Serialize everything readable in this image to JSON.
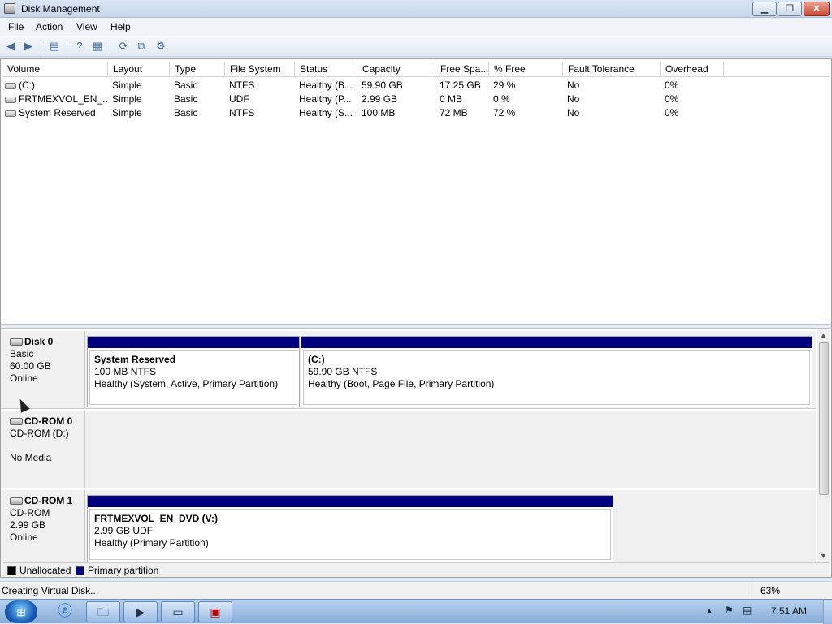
{
  "window": {
    "title": "Disk Management"
  },
  "menu": {
    "items": [
      "File",
      "Action",
      "View",
      "Help"
    ]
  },
  "toolbar": {
    "buttons": [
      "back-icon",
      "forward-icon",
      "console-tree-icon",
      "help-icon",
      "properties-icon",
      "refresh-icon",
      "rescan-icon",
      "settings-icon"
    ]
  },
  "volumes": {
    "columns": [
      "Volume",
      "Layout",
      "Type",
      "File System",
      "Status",
      "Capacity",
      "Free Spa...",
      "% Free",
      "Fault Tolerance",
      "Overhead"
    ],
    "rows": [
      {
        "volume": "(C:)",
        "layout": "Simple",
        "type": "Basic",
        "fs": "NTFS",
        "status": "Healthy (B...",
        "capacity": "59.90 GB",
        "free": "17.25 GB",
        "pfree": "29 %",
        "fault": "No",
        "overhead": "0%"
      },
      {
        "volume": "FRTMEXVOL_EN_...",
        "layout": "Simple",
        "type": "Basic",
        "fs": "UDF",
        "status": "Healthy (P...",
        "capacity": "2.99 GB",
        "free": "0 MB",
        "pfree": "0 %",
        "fault": "No",
        "overhead": "0%"
      },
      {
        "volume": "System Reserved",
        "layout": "Simple",
        "type": "Basic",
        "fs": "NTFS",
        "status": "Healthy (S...",
        "capacity": "100 MB",
        "free": "72 MB",
        "pfree": "72 %",
        "fault": "No",
        "overhead": "0%"
      }
    ]
  },
  "disks": [
    {
      "name": "Disk 0",
      "line1": "Basic",
      "line2": "60.00 GB",
      "line3": "Online",
      "partitions": [
        {
          "title": "System Reserved",
          "size": "100 MB NTFS",
          "status": "Healthy (System, Active, Primary Partition)"
        },
        {
          "title": "(C:)",
          "size": "59.90 GB NTFS",
          "status": "Healthy (Boot, Page File, Primary Partition)"
        }
      ]
    },
    {
      "name": "CD-ROM 0",
      "line1": "CD-ROM (D:)",
      "line2": "",
      "line3": "No Media",
      "partitions": []
    },
    {
      "name": "CD-ROM 1",
      "line1": "CD-ROM",
      "line2": "2.99 GB",
      "line3": "Online",
      "partitions": [
        {
          "title": "FRTMEXVOL_EN_DVD  (V:)",
          "size": "2.99 GB UDF",
          "status": "Healthy (Primary Partition)"
        }
      ]
    }
  ],
  "legend": [
    {
      "label": "Unallocated",
      "color": "#000000"
    },
    {
      "label": "Primary partition",
      "color": "#00007f"
    }
  ],
  "status": {
    "text": "Creating Virtual Disk...",
    "progress": "63%"
  },
  "taskbar": {
    "clock": "7:51 AM"
  }
}
